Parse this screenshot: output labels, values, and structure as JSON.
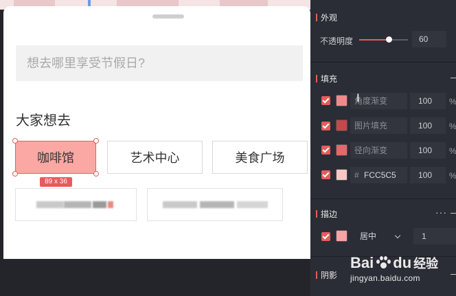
{
  "canvas": {
    "search_placeholder": "想去哪里享受节假日?",
    "section_title": "大家想去",
    "chips": [
      "咖啡馆",
      "艺术中心",
      "美食广场"
    ],
    "selection_size": "89 x 36"
  },
  "panel": {
    "appearance": {
      "title": "外观",
      "opacity_label": "不透明度",
      "opacity_value": "60",
      "opacity_level": 0.6
    },
    "fill": {
      "title": "填充",
      "rows": [
        {
          "label": "角度渐变",
          "value": "100",
          "unit": "%",
          "swatch": "#f08a8a"
        },
        {
          "label": "图片填充",
          "value": "100",
          "unit": "%",
          "swatch": "#c24a4a"
        },
        {
          "label": "径向渐变",
          "value": "100",
          "unit": "%",
          "swatch": "#e06a6a"
        },
        {
          "label": "#",
          "hex": "FCC5C5",
          "value": "100",
          "unit": "%",
          "swatch": "#FCC5C5"
        }
      ]
    },
    "stroke": {
      "title": "描边",
      "more": "···",
      "position": "居中",
      "width": "1",
      "swatch": "#f5a3a3"
    },
    "shadow": {
      "title": "阴影"
    }
  },
  "watermark": {
    "brand_a": "Bai",
    "brand_b": "du",
    "brand_c": "经验",
    "url": "jingyan.baidu.com"
  },
  "colors": {
    "accent": "#e55c5c",
    "selected_chip": "#fba8a4",
    "panel_bg": "#2a2d35"
  }
}
